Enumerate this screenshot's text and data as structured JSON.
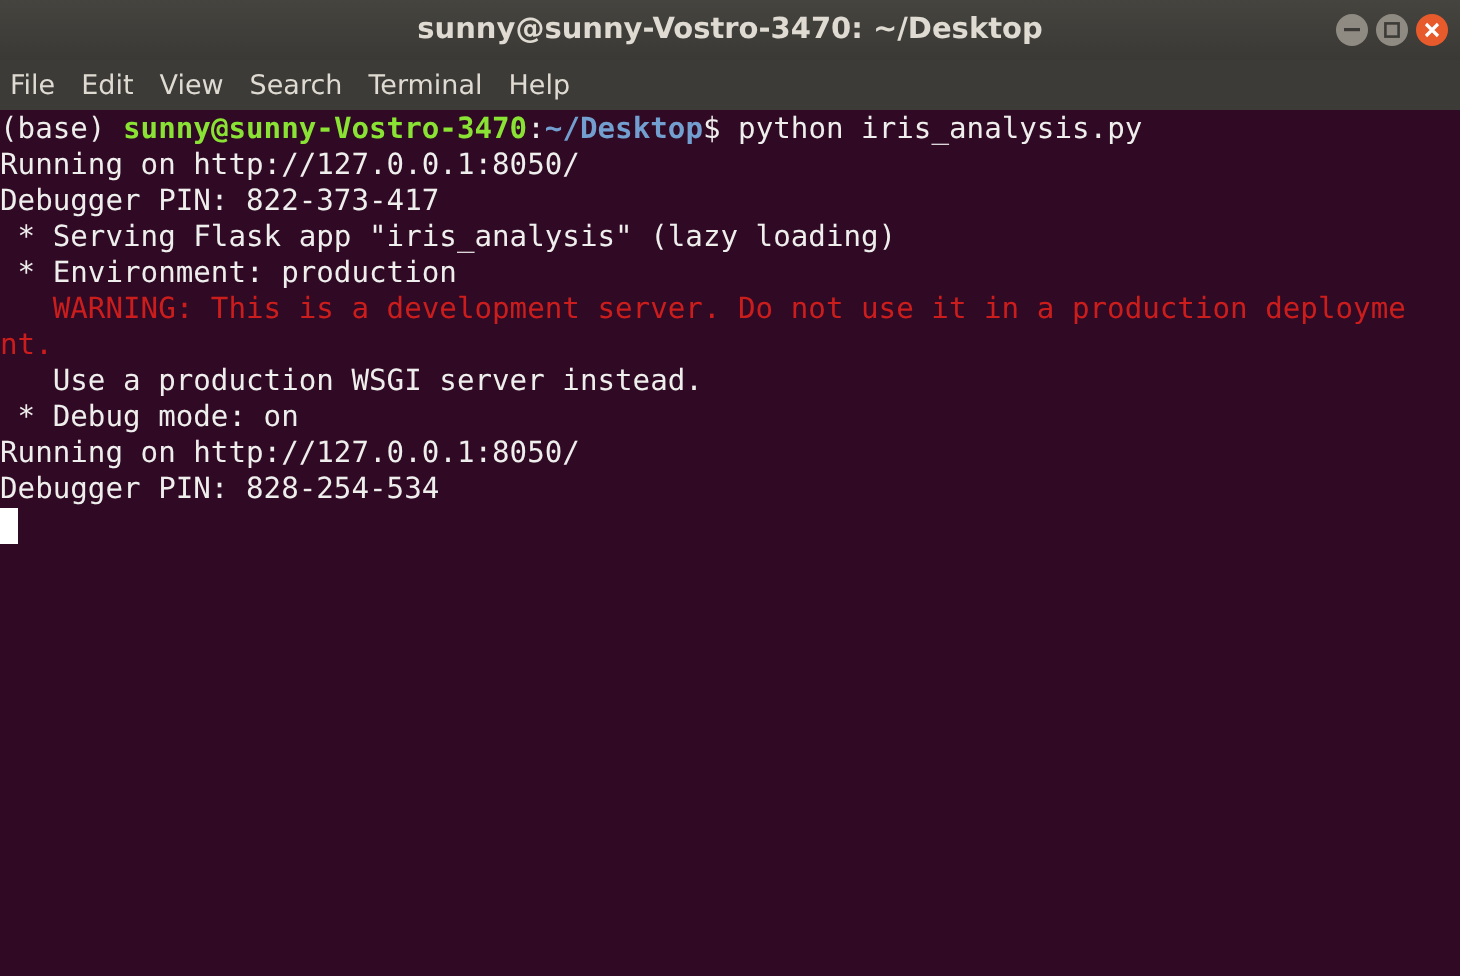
{
  "window": {
    "title": "sunny@sunny-Vostro-3470: ~/Desktop"
  },
  "menu": [
    "File",
    "Edit",
    "View",
    "Search",
    "Terminal",
    "Help"
  ],
  "terminal": {
    "lines": [
      [
        {
          "kind": "plain",
          "text": "(base) "
        },
        {
          "kind": "user",
          "text": "sunny@sunny-Vostro-3470"
        },
        {
          "kind": "plain",
          "text": ":"
        },
        {
          "kind": "path",
          "text": "~/Desktop"
        },
        {
          "kind": "plain",
          "text": "$ python iris_analysis.py"
        }
      ],
      [
        {
          "kind": "plain",
          "text": "Running on http://127.0.0.1:8050/"
        }
      ],
      [
        {
          "kind": "plain",
          "text": "Debugger PIN: 822-373-417"
        }
      ],
      [
        {
          "kind": "plain",
          "text": " * Serving Flask app \"iris_analysis\" (lazy loading)"
        }
      ],
      [
        {
          "kind": "plain",
          "text": " * Environment: production"
        }
      ],
      [
        {
          "kind": "warning",
          "text": "   WARNING: This is a development server. Do not use it in a production deployme"
        }
      ],
      [
        {
          "kind": "warning",
          "text": "nt."
        }
      ],
      [
        {
          "kind": "plain",
          "text": "   Use a production WSGI server instead."
        }
      ],
      [
        {
          "kind": "plain",
          "text": " * Debug mode: on"
        }
      ],
      [
        {
          "kind": "plain",
          "text": "Running on http://127.0.0.1:8050/"
        }
      ],
      [
        {
          "kind": "plain",
          "text": "Debugger PIN: 828-254-534"
        }
      ]
    ],
    "cursor": true
  }
}
